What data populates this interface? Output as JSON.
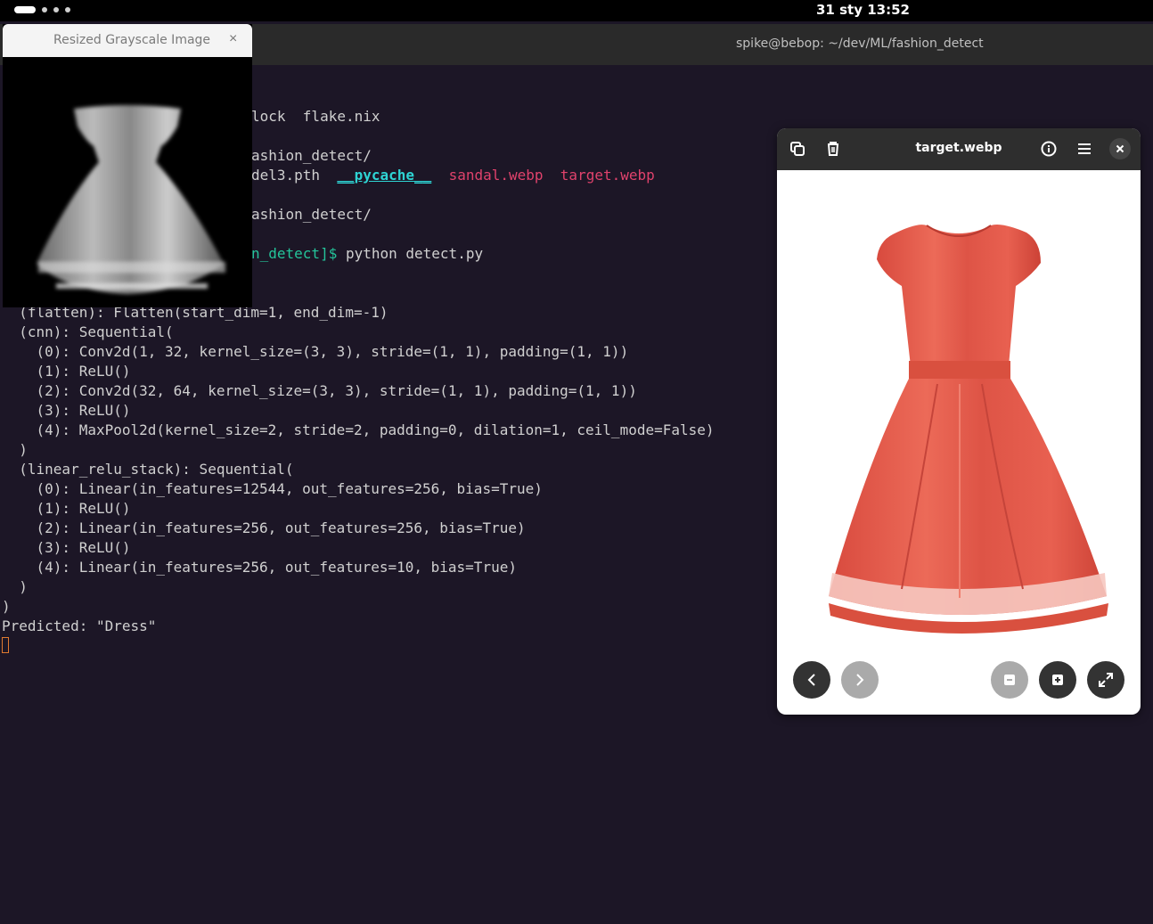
{
  "topbar": {
    "clock": "31 sty  13:52"
  },
  "terminal": {
    "title": "spike@bebop: ~/dev/ML/fashion_detect",
    "ls_line1": "lock  flake.nix",
    "path1": "ashion_detect/",
    "ls_line2_prefix": "del3.pth  ",
    "ls_pycache": "__pycache__",
    "ls_sandal": "sandal.webp",
    "ls_target": "target.webp",
    "path2": "ashion_detect/",
    "prompt_tail": "n_detect]$",
    "command": " python detect.py",
    "model_lines": [
      "  (flatten): Flatten(start_dim=1, end_dim=-1)",
      "  (cnn): Sequential(",
      "    (0): Conv2d(1, 32, kernel_size=(3, 3), stride=(1, 1), padding=(1, 1))",
      "    (1): ReLU()",
      "    (2): Conv2d(32, 64, kernel_size=(3, 3), stride=(1, 1), padding=(1, 1))",
      "    (3): ReLU()",
      "    (4): MaxPool2d(kernel_size=2, stride=2, padding=0, dilation=1, ceil_mode=False)",
      "  )",
      "  (linear_relu_stack): Sequential(",
      "    (0): Linear(in_features=12544, out_features=256, bias=True)",
      "    (1): ReLU()",
      "    (2): Linear(in_features=256, out_features=256, bias=True)",
      "    (3): ReLU()",
      "    (4): Linear(in_features=256, out_features=10, bias=True)",
      "  )",
      ")",
      "Predicted: \"Dress\""
    ]
  },
  "grayscale_window": {
    "title": "Resized Grayscale Image",
    "close": "×"
  },
  "viewer": {
    "title": "target.webp",
    "icons": [
      "copy-icon",
      "trash-icon",
      "info-icon",
      "menu-icon",
      "close-icon"
    ],
    "controls": [
      "previous-icon",
      "next-icon",
      "zoom-out-icon",
      "zoom-in-icon",
      "fullscreen-icon"
    ],
    "dress_color": "#e35a4c"
  }
}
